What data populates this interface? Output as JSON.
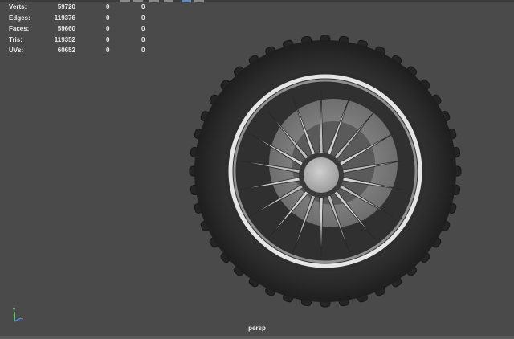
{
  "stats": [
    {
      "label": "Verts:",
      "v1": "59720",
      "v2": "0",
      "v3": "0"
    },
    {
      "label": "Edges:",
      "v1": "119376",
      "v2": "0",
      "v3": "0"
    },
    {
      "label": "Faces:",
      "v1": "59660",
      "v2": "0",
      "v3": "0"
    },
    {
      "label": "Tris:",
      "v1": "119352",
      "v2": "0",
      "v3": "0"
    },
    {
      "label": "UVs:",
      "v1": "60652",
      "v2": "0",
      "v3": "0"
    }
  ],
  "camera": "persp",
  "axis": {
    "y": "y",
    "z": "z"
  },
  "colors": {
    "viewport_bg": "#4a4a4a",
    "tire": "#2a2a2a",
    "rim": "#d8d8d8",
    "spoke": "#c8c8c8",
    "hub": "#b8b8b8"
  }
}
